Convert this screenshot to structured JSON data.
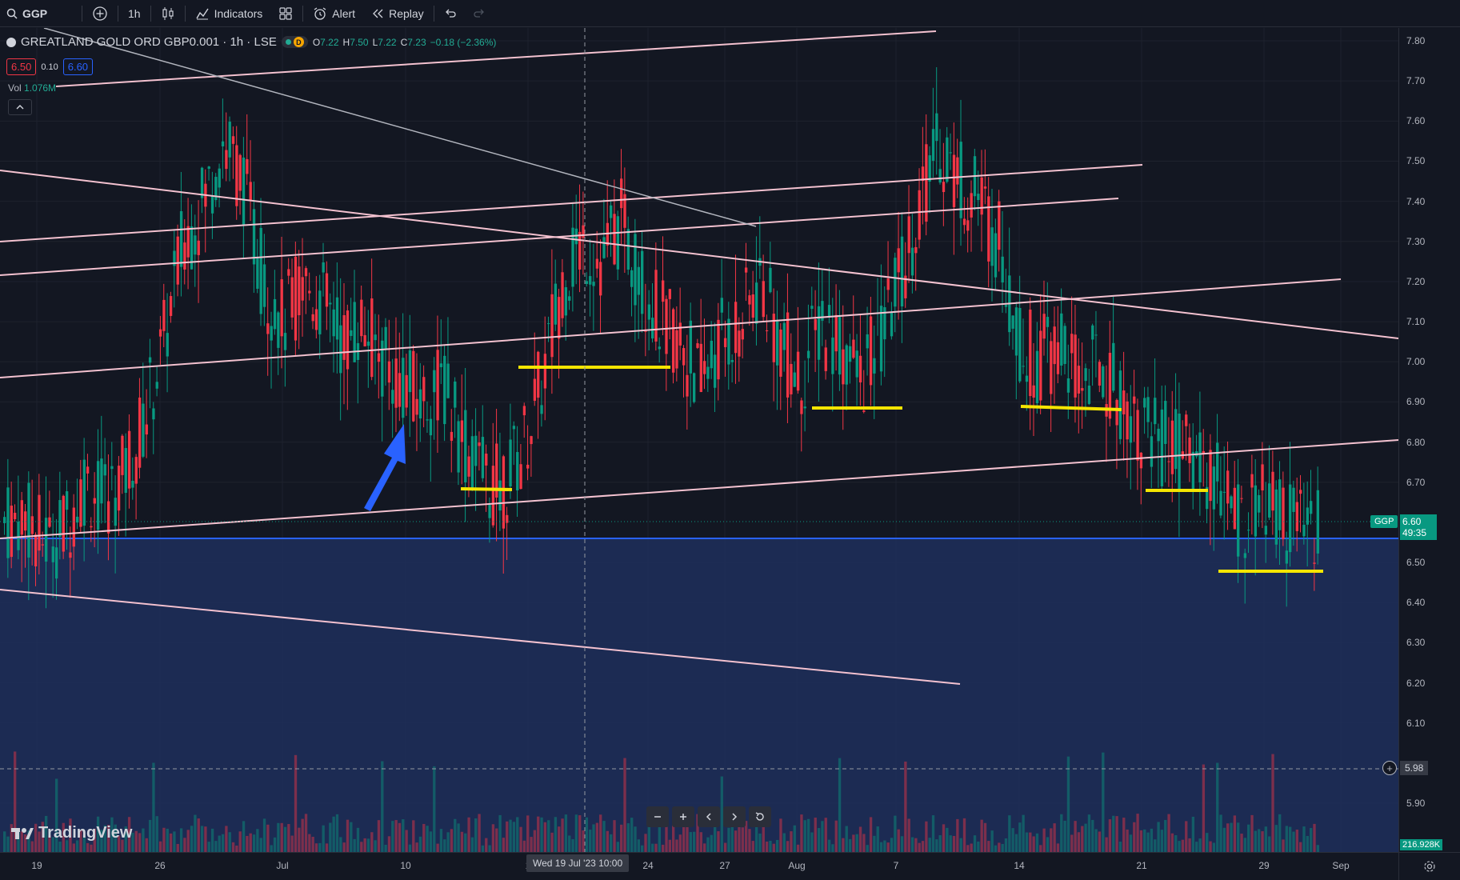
{
  "toolbar": {
    "symbol": "GGP",
    "interval": "1h",
    "indicators_label": "Indicators",
    "alert_label": "Alert",
    "replay_label": "Replay"
  },
  "legend": {
    "title": "GREATLAND GOLD ORD GBP0.001 · 1h · LSE",
    "badge": "D",
    "open_label": "O",
    "open": "7.22",
    "high_label": "H",
    "high": "7.50",
    "low_label": "L",
    "low": "7.22",
    "close_label": "C",
    "close": "7.23",
    "change": "−0.18 (−2.36%)",
    "bid": "6.50",
    "spread": "0.10",
    "ask": "6.60",
    "vol_label": "Vol",
    "vol_value": "1.076M"
  },
  "branding": {
    "logo_text": "TradingView"
  },
  "price_axis": {
    "labels": [
      "7.80",
      "7.70",
      "7.60",
      "7.50",
      "7.40",
      "7.30",
      "7.20",
      "7.10",
      "7.00",
      "6.90",
      "6.80",
      "6.70",
      "6.50",
      "6.40",
      "6.30",
      "6.20",
      "6.10",
      "5.90"
    ],
    "symbol_tag": "GGP",
    "last_price": "6.60",
    "countdown": "49:35",
    "crosshair_price": "5.98",
    "volume_value": "216.928K"
  },
  "time_axis": {
    "labels": [
      "19",
      "26",
      "Jul",
      "10",
      "1",
      "24",
      "27",
      "Aug",
      "7",
      "14",
      "21",
      "29",
      "Sep"
    ],
    "crosshair_time": "Wed 19 Jul '23   10:00"
  },
  "colors": {
    "up": "#089981",
    "down": "#f23645",
    "trendline": "#f4c2d0",
    "support": "#f5e500",
    "arrow": "#2962ff",
    "zone": "#1e2f5c",
    "background": "#131722"
  },
  "chart_data": {
    "type": "candlestick",
    "symbol": "GGP",
    "interval": "1h",
    "x_range": [
      "19 Jun 2023",
      "1 Sep 2023"
    ],
    "y_range": [
      5.85,
      7.82
    ],
    "close_series": [
      6.6,
      6.62,
      6.55,
      6.58,
      6.7,
      6.65,
      6.72,
      6.85,
      7.05,
      7.3,
      7.4,
      7.55,
      7.45,
      7.2,
      7.1,
      7.2,
      7.15,
      7.05,
      7.1,
      7.0,
      6.95,
      6.9,
      6.95,
      6.8,
      6.72,
      6.68,
      6.78,
      6.95,
      7.2,
      7.3,
      7.25,
      7.35,
      7.2,
      7.1,
      7.05,
      6.95,
      7.05,
      7.1,
      7.2,
      7.05,
      6.95,
      7.1,
      7.05,
      6.95,
      7.05,
      7.2,
      7.4,
      7.55,
      7.45,
      7.4,
      7.3,
      7.05,
      7.0,
      7.05,
      6.95,
      7.0,
      6.92,
      6.85,
      6.8,
      6.78,
      6.75,
      6.7,
      6.6,
      6.65,
      6.62,
      6.58,
      6.6
    ]
  }
}
